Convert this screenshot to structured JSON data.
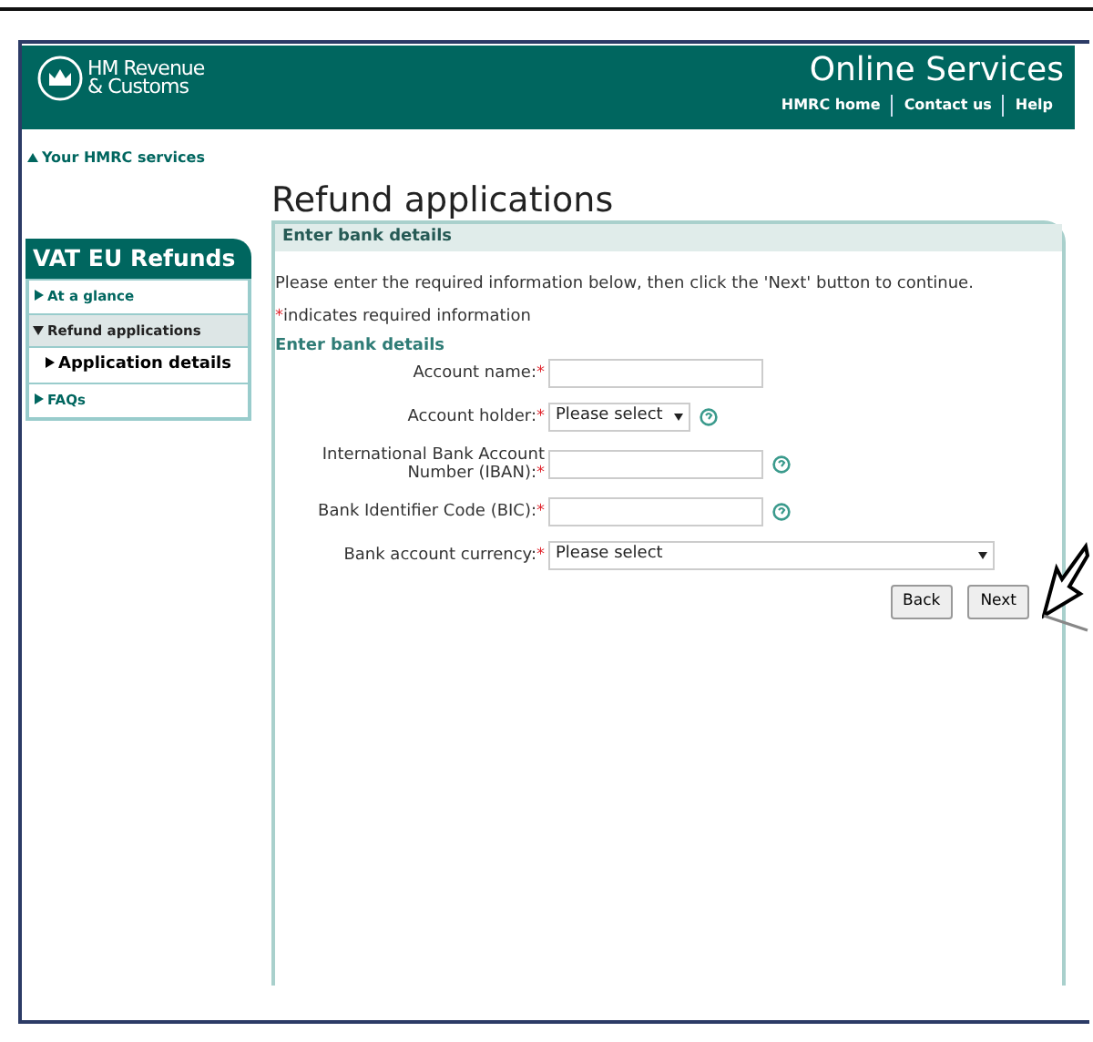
{
  "header": {
    "logo_lines": [
      "HM Revenue",
      "& Customs"
    ],
    "title": "Online Services",
    "links": [
      "HMRC home",
      "Contact us",
      "Help"
    ]
  },
  "back_link": "Your HMRC services",
  "sidebar": {
    "title": "VAT EU Refunds",
    "items": [
      {
        "label": "At a glance",
        "expanded": false
      },
      {
        "label": "Refund applications",
        "expanded": true,
        "children": [
          {
            "label": "Application details",
            "selected": true
          }
        ]
      },
      {
        "label": "FAQs",
        "expanded": false
      }
    ]
  },
  "page": {
    "title": "Refund applications",
    "panel_title": "Enter bank details",
    "intro": "Please enter the required information below, then click the 'Next' button to continue.",
    "required_mark": "*",
    "required_note": "indicates required information",
    "section_heading": "Enter bank details",
    "fields": [
      {
        "label": "Account name:",
        "kind": "text",
        "required": true,
        "help": false
      },
      {
        "label": "Account holder:",
        "kind": "select",
        "value": "Please select",
        "required": true,
        "help": true
      },
      {
        "label": "International Bank Account Number (IBAN):",
        "kind": "text",
        "required": true,
        "help": true
      },
      {
        "label": "Bank Identifier Code (BIC):",
        "kind": "text",
        "required": true,
        "help": true
      },
      {
        "label": "Bank account currency:",
        "kind": "wide-select",
        "value": "Please select",
        "required": true,
        "help": false
      }
    ],
    "buttons": [
      "Back",
      "Next"
    ]
  }
}
